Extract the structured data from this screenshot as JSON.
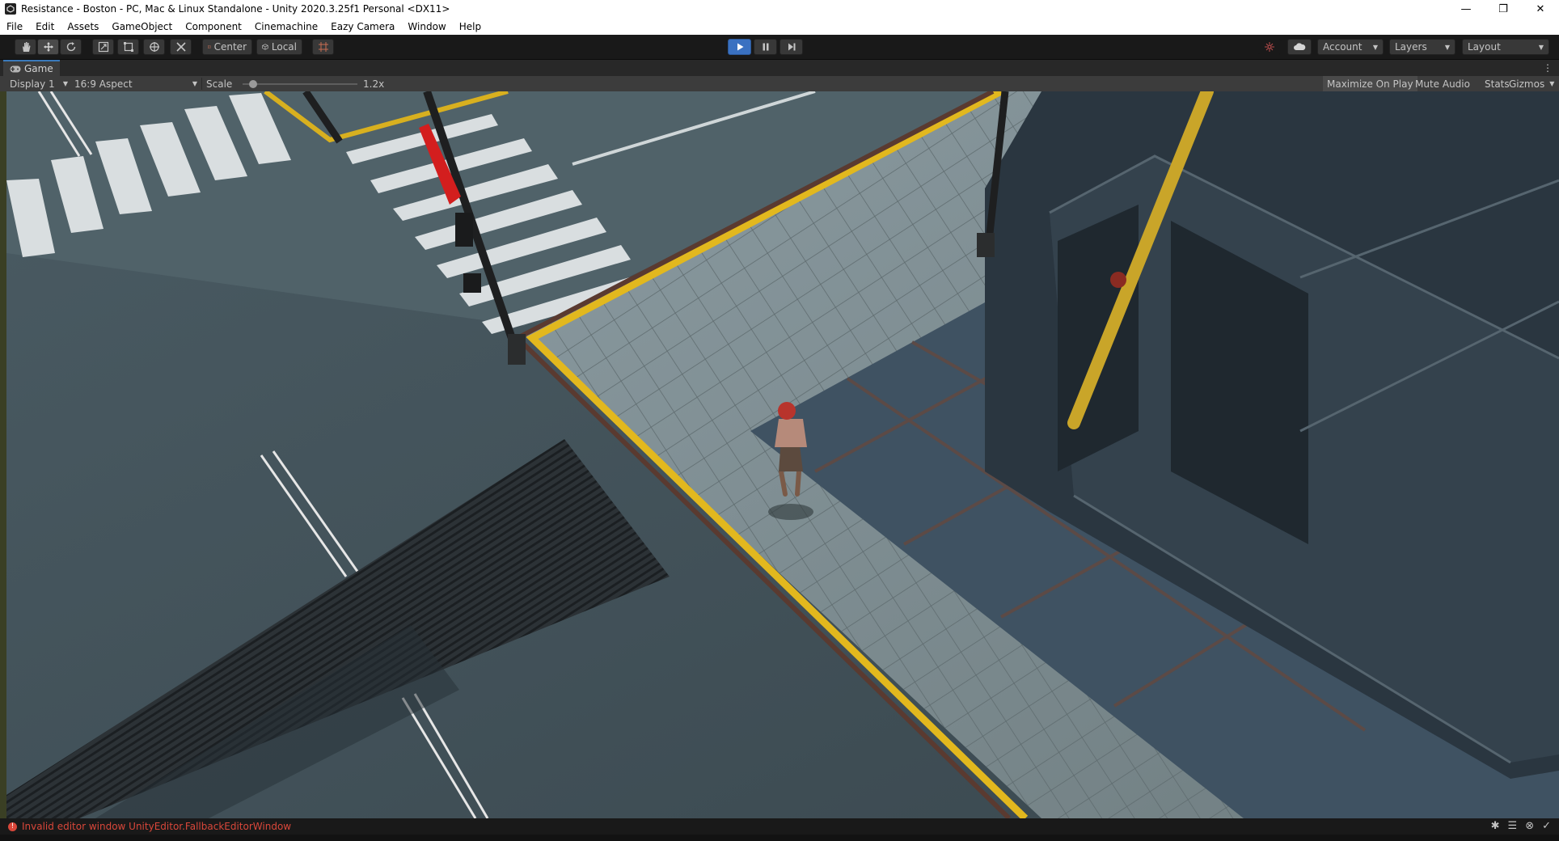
{
  "window": {
    "title": "Resistance - Boston - PC, Mac & Linux Standalone - Unity 2020.3.25f1 Personal <DX11>",
    "minimize": "—",
    "restore": "❐",
    "close": "✕"
  },
  "menu": {
    "items": [
      "File",
      "Edit",
      "Assets",
      "GameObject",
      "Component",
      "Cinemachine",
      "Eazy Camera",
      "Window",
      "Help"
    ]
  },
  "toolbar": {
    "tools": [
      "hand-icon",
      "move-icon",
      "rotate-icon",
      "scale-icon",
      "rect-icon",
      "transform-icon",
      "custom-tool-icon"
    ],
    "pivot_mode": "Center",
    "pivot_rotation": "Local",
    "account": "Account",
    "layers": "Layers",
    "layout": "Layout"
  },
  "game_view": {
    "tab_label": "Game",
    "display": "Display 1",
    "aspect": "16:9 Aspect",
    "scale_label": "Scale",
    "scale_value": "1.2x",
    "maximize_on_play": "Maximize On Play",
    "mute_audio": "Mute Audio",
    "stats": "Stats",
    "gizmos": "Gizmos"
  },
  "status": {
    "message": "Invalid editor window UnityEditor.FallbackEditorWindow"
  },
  "colors": {
    "accent": "#3a71c1",
    "error": "#d9473a",
    "curb_yellow": "#e2b81e"
  }
}
